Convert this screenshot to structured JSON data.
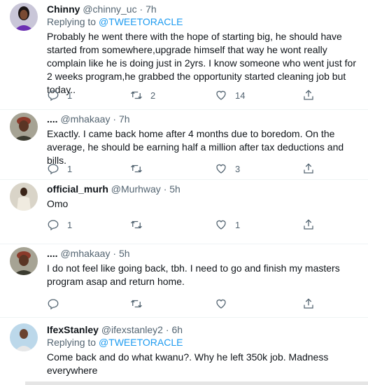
{
  "tweets": [
    {
      "name": "Chinny",
      "handle": "@chinny_uc",
      "time": "7h",
      "replying_prefix": "Replying to",
      "replying_to": "@TWEETORACLE",
      "text": "Probably he went there with the hope of starting big, he should have started from somewhere,upgrade himself that way he wont really complain like he is doing just in 2yrs. I know someone who went just for 2 weeks program,he grabbed the opportunity started cleaning job but today..",
      "replies": "1",
      "retweets": "2",
      "likes": "14"
    },
    {
      "name": "....",
      "handle": "@mhakaay",
      "time": "7h",
      "text": "Exactly. I came back home after 4 months due to boredom. On the average, he should be earning half a million after tax deductions and bills.",
      "replies": "1",
      "retweets": "",
      "likes": "3"
    },
    {
      "name": "official_murh",
      "handle": "@Murhway",
      "time": "5h",
      "text": "Omo",
      "replies": "1",
      "retweets": "",
      "likes": "1"
    },
    {
      "name": "....",
      "handle": "@mhakaay",
      "time": "5h",
      "text": "I do not feel like going back, tbh. I need to go and finish my masters program asap and return home.",
      "replies": "",
      "retweets": "",
      "likes": ""
    },
    {
      "name": "IfexStanley",
      "handle": "@ifexstanley2",
      "time": "6h",
      "replying_prefix": "Replying to",
      "replying_to": "@TWEETORACLE",
      "text": "Come back and do what kwanu?.  Why he left 350k job. Madness everywhere"
    }
  ],
  "separator": "·",
  "colors": {
    "link": "#1d9bf0",
    "secondary": "#536471",
    "divider": "#eff3f4"
  }
}
